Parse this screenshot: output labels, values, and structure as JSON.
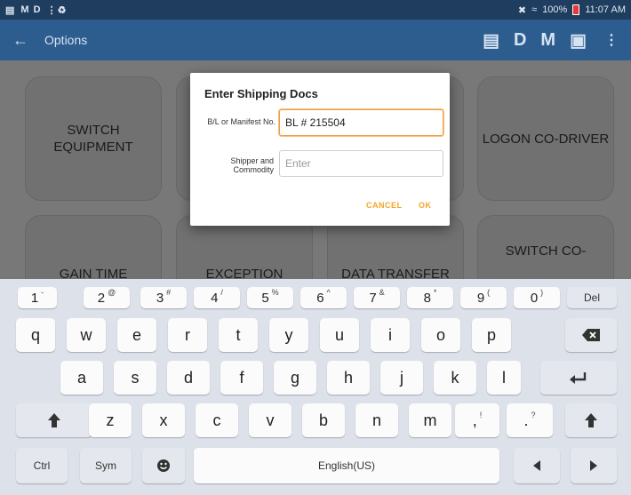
{
  "status_bar": {
    "left_icons": [
      "message-icon",
      "M",
      "D",
      "···",
      "usb-icon"
    ],
    "left_text": "M D",
    "battery": "100%",
    "time": "11:07 AM"
  },
  "app_bar": {
    "back_glyph": "←",
    "title": "Options",
    "actions": [
      "D",
      "M"
    ]
  },
  "tiles": [
    {
      "label": "SWITCH EQUIPMENT"
    },
    {
      "label": "LOGON CO-DRIVER"
    },
    {
      "label": "GAIN TIME"
    },
    {
      "label": "EXCEPTION"
    },
    {
      "label": "DATA TRANSFER"
    },
    {
      "label": "SWITCH CO-"
    }
  ],
  "dialog": {
    "title": "Enter Shipping Docs",
    "bl_label": "B/L or Manifest No.",
    "bl_value": "BL # 215504",
    "shipper_label_line1": "Shipper and",
    "shipper_label_line2": "Commodity",
    "shipper_placeholder": "Enter",
    "cancel": "CANCEL",
    "ok": "OK"
  },
  "keyboard": {
    "number_row": [
      {
        "main": "1",
        "alt": "-"
      },
      {
        "main": "2",
        "alt": "@"
      },
      {
        "main": "3",
        "alt": "#"
      },
      {
        "main": "4",
        "alt": "/"
      },
      {
        "main": "5",
        "alt": "%"
      },
      {
        "main": "6",
        "alt": "^"
      },
      {
        "main": "7",
        "alt": "&"
      },
      {
        "main": "8",
        "alt": "*"
      },
      {
        "main": "9",
        "alt": "("
      },
      {
        "main": "0",
        "alt": ")"
      }
    ],
    "del": "Del",
    "row1": [
      "q",
      "w",
      "e",
      "r",
      "t",
      "y",
      "u",
      "i",
      "o",
      "p"
    ],
    "row2": [
      "a",
      "s",
      "d",
      "f",
      "g",
      "h",
      "j",
      "k",
      "l"
    ],
    "row3": [
      "z",
      "x",
      "c",
      "v",
      "b",
      "n",
      "m"
    ],
    "comma": ",",
    "comma_alt": "!",
    "period": ".",
    "period_alt": "?",
    "ctrl": "Ctrl",
    "sym": "Sym",
    "space": "English(US)"
  }
}
